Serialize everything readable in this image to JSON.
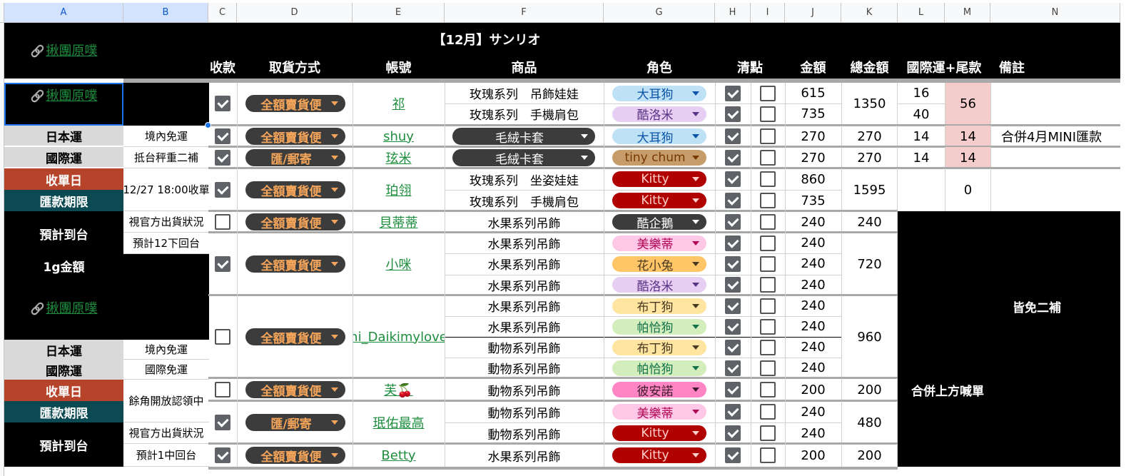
{
  "columns": [
    "A",
    "B",
    "C",
    "D",
    "E",
    "F",
    "G",
    "H",
    "I",
    "J",
    "K",
    "L",
    "M",
    "N"
  ],
  "title": "【12月】サンリオ",
  "headers": {
    "paid": "收款",
    "pickup": "取貨方式",
    "account": "帳號",
    "product": "商品",
    "character": "角色",
    "check": "清點",
    "amount": "金額",
    "total": "總金額",
    "intl": "國際運+尾款",
    "note": "備註"
  },
  "left": {
    "link_label": "揪團原噗",
    "japan_ship": "日本運",
    "japan_free": "境內免運",
    "intl_ship": "國際運",
    "intl_note": "抵台秤重二補",
    "close_day": "收單日",
    "close_date": "12/27 18:00收單",
    "pay_deadline": "匯款期限",
    "eta": "預計到台",
    "status1": "視官方出貨狀況",
    "eta1": "預計12下回台",
    "per_gram": "1g金額",
    "intl_free": "國際免運",
    "claim_open": "餘角開放認領中",
    "status2": "視官方出貨狀況",
    "eta2": "預計1中回台"
  },
  "orders": [
    {
      "paid": true,
      "pickup": "全額賣貨便",
      "account": "祁",
      "total": "1350",
      "intl": "16",
      "intl2": "40",
      "balance": "56",
      "note": "",
      "items": [
        {
          "product": "玫瑰系列　吊飾娃娃",
          "char": "大耳狗",
          "amount": "615",
          "checked": true
        },
        {
          "product": "玫瑰系列　手機肩包",
          "char": "酷洛米",
          "amount": "735",
          "checked": true
        }
      ]
    },
    {
      "paid": true,
      "pickup": "全額賣貨便",
      "account": "shuy",
      "total": "270",
      "intl": "14",
      "balance": "14",
      "note": "合併4月MINI匯款",
      "items": [
        {
          "product": "毛絨卡套",
          "char": "大耳狗",
          "amount": "270",
          "checked": true
        }
      ]
    },
    {
      "paid": true,
      "pickup": "匯/郵寄",
      "account": "玹米",
      "total": "270",
      "intl": "14",
      "balance": "14",
      "note": "",
      "items": [
        {
          "product": "毛絨卡套",
          "char": "tiny chum",
          "amount": "270",
          "checked": true
        }
      ]
    },
    {
      "paid": true,
      "pickup": "全額賣貨便",
      "account": "珀翎",
      "total": "1595",
      "intl": "",
      "balance": "0",
      "note": "",
      "items": [
        {
          "product": "玫瑰系列　坐姿娃娃",
          "char": "Kitty",
          "amount": "860",
          "checked": true
        },
        {
          "product": "玫瑰系列　手機肩包",
          "char": "Kitty",
          "amount": "735",
          "checked": true
        }
      ]
    },
    {
      "paid": false,
      "pickup": "全額賣貨便",
      "account": "貝蒂蒂",
      "total": "240",
      "items": [
        {
          "product": "水果系列吊飾",
          "char": "酷企鵝",
          "amount": "240",
          "checked": true
        }
      ]
    },
    {
      "paid": true,
      "pickup": "全額賣貨便",
      "account": "小咪",
      "total": "720",
      "items": [
        {
          "product": "水果系列吊飾",
          "char": "美樂蒂",
          "amount": "240",
          "checked": true
        },
        {
          "product": "水果系列吊飾",
          "char": "花小兔",
          "amount": "240",
          "checked": true
        },
        {
          "product": "水果系列吊飾",
          "char": "酷洛米",
          "amount": "240",
          "checked": true
        }
      ]
    },
    {
      "paid": false,
      "pickup": "全額賣貨便",
      "account": "hi_Daikimylove",
      "total": "960",
      "items": [
        {
          "product": "水果系列吊飾",
          "char": "布丁狗",
          "amount": "240",
          "checked": true
        },
        {
          "product": "水果系列吊飾",
          "char": "帕恰狗",
          "amount": "240",
          "checked": true
        },
        {
          "product": "動物系列吊飾",
          "char": "布丁狗",
          "amount": "240",
          "checked": true
        },
        {
          "product": "動物系列吊飾",
          "char": "帕恰狗",
          "amount": "240",
          "checked": true
        }
      ]
    },
    {
      "paid": false,
      "pickup": "全額賣貨便",
      "account": "芙🍒",
      "total": "200",
      "items": [
        {
          "product": "動物系列吊飾",
          "char": "彼安諾",
          "amount": "200",
          "checked": true
        }
      ]
    },
    {
      "paid": true,
      "pickup": "匯/郵寄",
      "account": "珉佑最高",
      "total": "480",
      "items": [
        {
          "product": "動物系列吊飾",
          "char": "美樂蒂",
          "amount": "240",
          "checked": true
        },
        {
          "product": "動物系列吊飾",
          "char": "Kitty",
          "amount": "240",
          "checked": true
        }
      ]
    },
    {
      "paid": true,
      "pickup": "全額賣貨便",
      "account": "Betty",
      "total": "200",
      "items": [
        {
          "product": "水果系列吊飾",
          "char": "Kitty",
          "amount": "200",
          "checked": true
        }
      ]
    }
  ],
  "merged_notes": {
    "no_second": "皆免二補",
    "merge_above": "合併上方喊單"
  },
  "char_colors": {
    "大耳狗": [
      "#bfe1f6",
      "#0a53a8"
    ],
    "酷洛米": [
      "#e6cff2",
      "#5a3286"
    ],
    "tiny chum": [
      "#c69d6a",
      "#753800"
    ],
    "Kitty": [
      "#b10202",
      "#ffcfc9"
    ],
    "酷企鵝": [
      "#3c3c3c",
      "#ffffff"
    ],
    "美樂蒂": [
      "#ffc8e6",
      "#b10255"
    ],
    "花小兔": [
      "#ffc567",
      "#473821"
    ],
    "布丁狗": [
      "#ffe5a0",
      "#473821"
    ],
    "帕恰狗": [
      "#d4edbc",
      "#11734b"
    ],
    "彼安諾": [
      "#ff85c4",
      "#3d1a2c"
    ]
  }
}
